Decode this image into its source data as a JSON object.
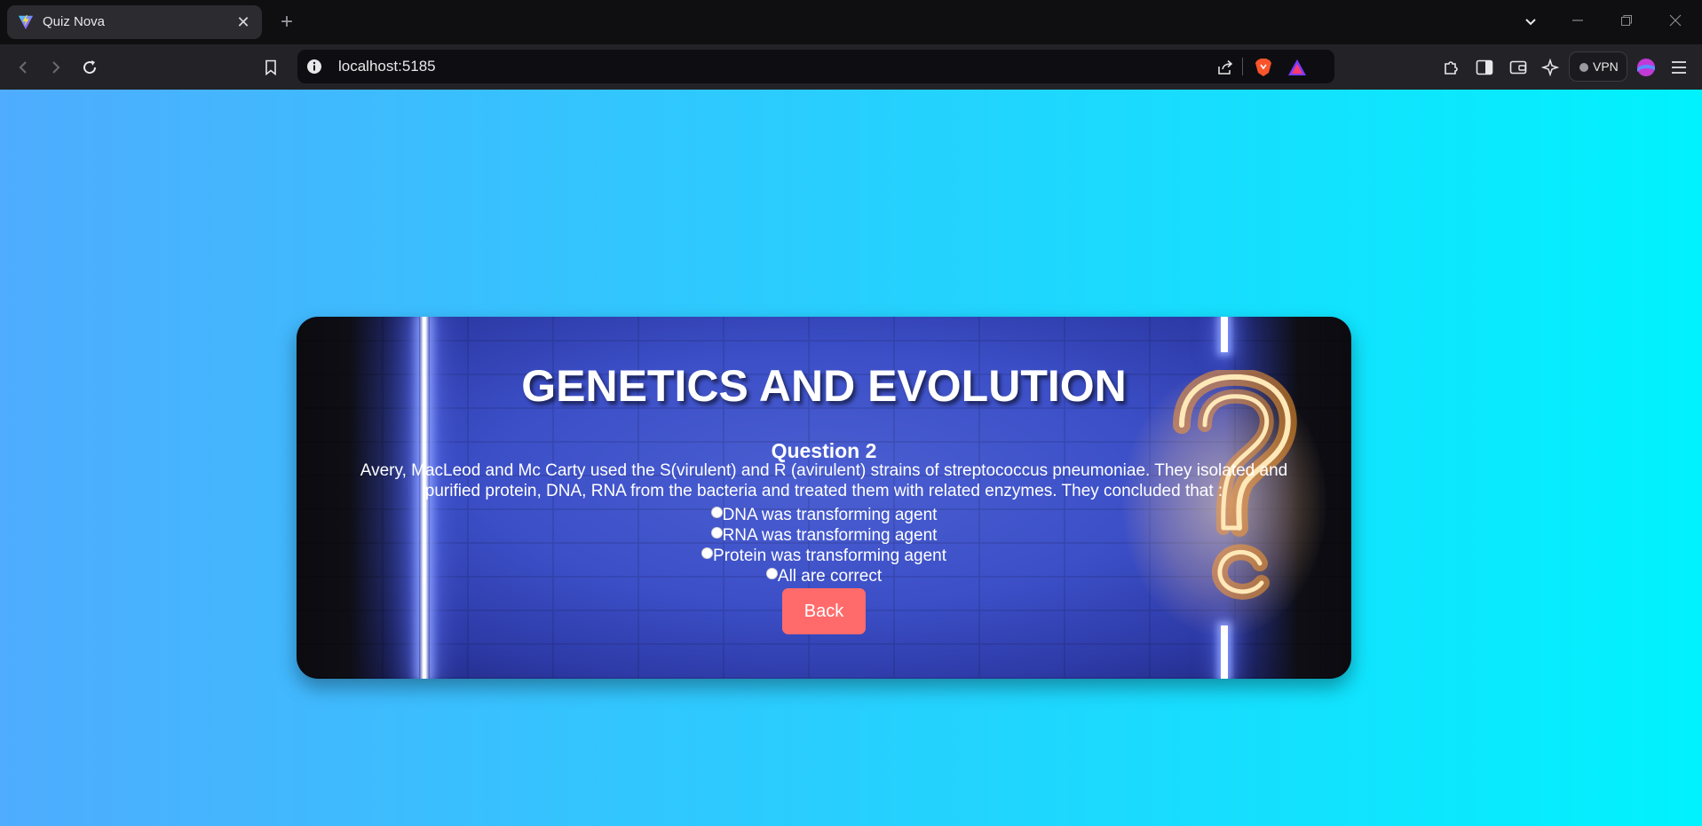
{
  "browser": {
    "tab_title": "Quiz Nova",
    "tab_close": "✕",
    "new_tab": "+",
    "url": "localhost:5185",
    "vpn_label": "VPN"
  },
  "quiz": {
    "title": "GENETICS AND EVOLUTION",
    "question_number": "Question 2",
    "question_text": "Avery, MacLeod and Mc Carty used the S(virulent) and R (avirulent) strains of streptococcus pneumoniae. They isolated and purified protein, DNA, RNA from the bacteria and treated them with related enzymes. They concluded that :",
    "options": [
      {
        "label": "DNA was transforming agent"
      },
      {
        "label": "RNA was transforming agent"
      },
      {
        "label": "Protein was transforming agent"
      },
      {
        "label": "All are correct"
      }
    ],
    "back_label": "Back"
  },
  "colors": {
    "page_gradient_start": "#4facfe",
    "page_gradient_end": "#00f2fe",
    "card_blue": "#3c4fc7",
    "back_button": "#ff6b6b",
    "neon_question_mark": "#ffb347"
  },
  "icons": {
    "favicon": "vite-logo-icon",
    "question_mark_decoration": "neon-question-mark-icon"
  }
}
